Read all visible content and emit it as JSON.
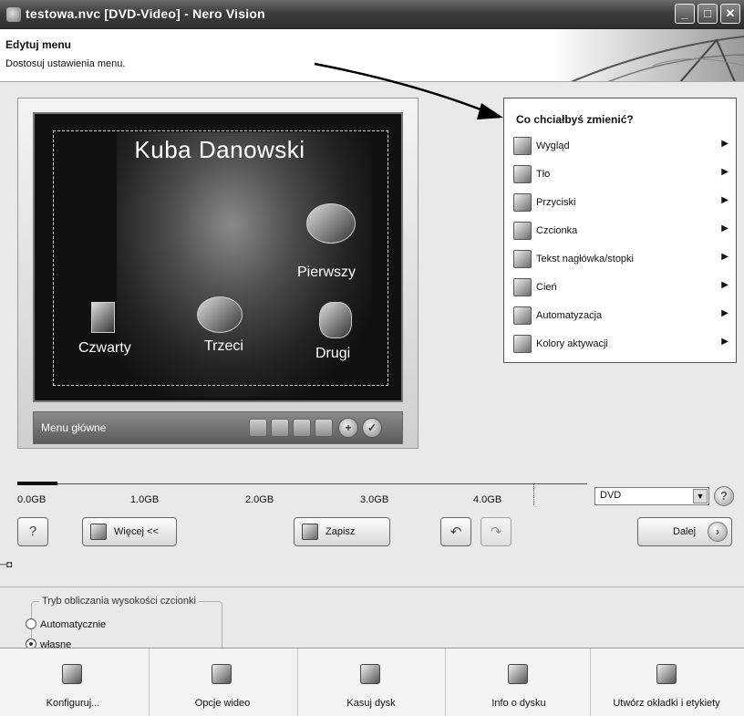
{
  "window": {
    "title": "testowa.nvc [DVD-Video] - Nero Vision",
    "minimize": "_",
    "maximize": "□",
    "close": "✕"
  },
  "header": {
    "title": "Edytuj menu",
    "subtitle": "Dostosuj ustawienia menu."
  },
  "preview": {
    "menu_title": "Kuba Danowski",
    "buttons": [
      "Pierwszy",
      "Drugi",
      "Trzeci",
      "Czwarty"
    ],
    "bar_label": "Menu główne"
  },
  "change_menu": {
    "title": "Co chciałbyś zmienić?",
    "items": [
      {
        "label": "Wygląd",
        "icon": "layout-icon"
      },
      {
        "label": "Tło",
        "icon": "background-icon"
      },
      {
        "label": "Przyciski",
        "icon": "buttons-icon"
      },
      {
        "label": "Czcionka",
        "icon": "font-icon"
      },
      {
        "label": "Tekst nagłówka/stopki",
        "icon": "header-footer-text-icon"
      },
      {
        "label": "Cień",
        "icon": "shadow-icon"
      },
      {
        "label": "Automatyzacja",
        "icon": "automation-icon"
      },
      {
        "label": "Kolory aktywacji",
        "icon": "activation-colors-icon"
      }
    ]
  },
  "disc": {
    "ticks": [
      "0.0GB",
      "1.0GB",
      "2.0GB",
      "3.0GB",
      "4.0GB"
    ],
    "used_fraction": 0.07,
    "type": "DVD"
  },
  "actions": {
    "more": "Więcej <<",
    "save": "Zapisz",
    "next": "Dalej"
  },
  "font_height": {
    "legend": "Tryb obliczania wysokości czcionki",
    "options": [
      "Automatycznie",
      "własne"
    ],
    "selected": "własne"
  },
  "bottom_toolbar": [
    {
      "label": "Konfiguruj...",
      "icon": "hammer-icon"
    },
    {
      "label": "Opcje wideo",
      "icon": "video-options-icon"
    },
    {
      "label": "Kasuj dysk",
      "icon": "erase-disc-icon"
    },
    {
      "label": "Info o dysku",
      "icon": "disc-info-icon"
    },
    {
      "label": "Utwórz okładki i etykiety",
      "icon": "cover-label-icon"
    }
  ]
}
